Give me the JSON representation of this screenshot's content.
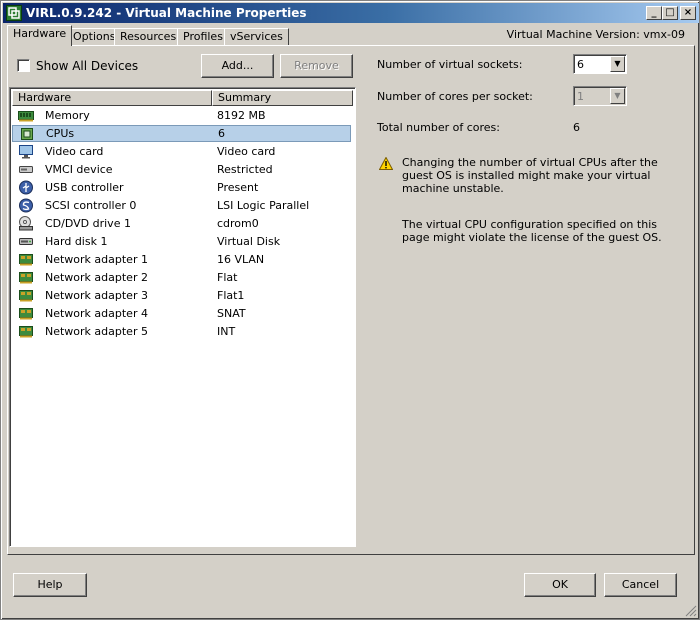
{
  "window": {
    "title": "VIRL.0.9.242 - Virtual Machine Properties",
    "vm_version": "Virtual Machine Version: vmx-09"
  },
  "tabs": [
    "Hardware",
    "Options",
    "Resources",
    "Profiles",
    "vServices"
  ],
  "active_tab": "Hardware",
  "show_all_devices": {
    "label": "Show All Devices",
    "checked": false
  },
  "buttons": {
    "add": "Add...",
    "remove": "Remove",
    "help": "Help",
    "ok": "OK",
    "cancel": "Cancel"
  },
  "columns": {
    "hardware": "Hardware",
    "summary": "Summary"
  },
  "devices": [
    {
      "name": "Memory",
      "summary": "8192 MB",
      "icon": "memory-icon"
    },
    {
      "name": "CPUs",
      "summary": "6",
      "icon": "cpu-icon",
      "selected": true
    },
    {
      "name": "Video card",
      "summary": "Video card",
      "icon": "monitor-icon"
    },
    {
      "name": "VMCI device",
      "summary": "Restricted",
      "icon": "device-icon"
    },
    {
      "name": "USB controller",
      "summary": "Present",
      "icon": "usb-icon"
    },
    {
      "name": "SCSI controller 0",
      "summary": "LSI Logic Parallel",
      "icon": "scsi-icon"
    },
    {
      "name": "CD/DVD drive 1",
      "summary": "cdrom0",
      "icon": "cd-drive-icon"
    },
    {
      "name": "Hard disk 1",
      "summary": "Virtual Disk",
      "icon": "hard-disk-icon"
    },
    {
      "name": "Network adapter 1",
      "summary": "16 VLAN",
      "icon": "network-adapter-icon"
    },
    {
      "name": "Network adapter 2",
      "summary": "Flat",
      "icon": "network-adapter-icon"
    },
    {
      "name": "Network adapter 3",
      "summary": "Flat1",
      "icon": "network-adapter-icon"
    },
    {
      "name": "Network adapter 4",
      "summary": "SNAT",
      "icon": "network-adapter-icon"
    },
    {
      "name": "Network adapter 5",
      "summary": "INT",
      "icon": "network-adapter-icon"
    }
  ],
  "cpu": {
    "sockets_label": "Number of virtual sockets:",
    "sockets_value": "6",
    "cores_label": "Number of cores per socket:",
    "cores_value": "1",
    "total_label": "Total number of cores:",
    "total_value": "6",
    "warning": "Changing the number of virtual CPUs after the guest OS is installed might make your virtual machine unstable.",
    "license_note": "The virtual CPU configuration specified on this page might violate the license of the guest OS."
  },
  "colors": {
    "title_gradient_start": "#0a246a",
    "title_gradient_end": "#a6caf0",
    "selection": "#b7d0e8",
    "window_bg": "#d4d0c8"
  }
}
